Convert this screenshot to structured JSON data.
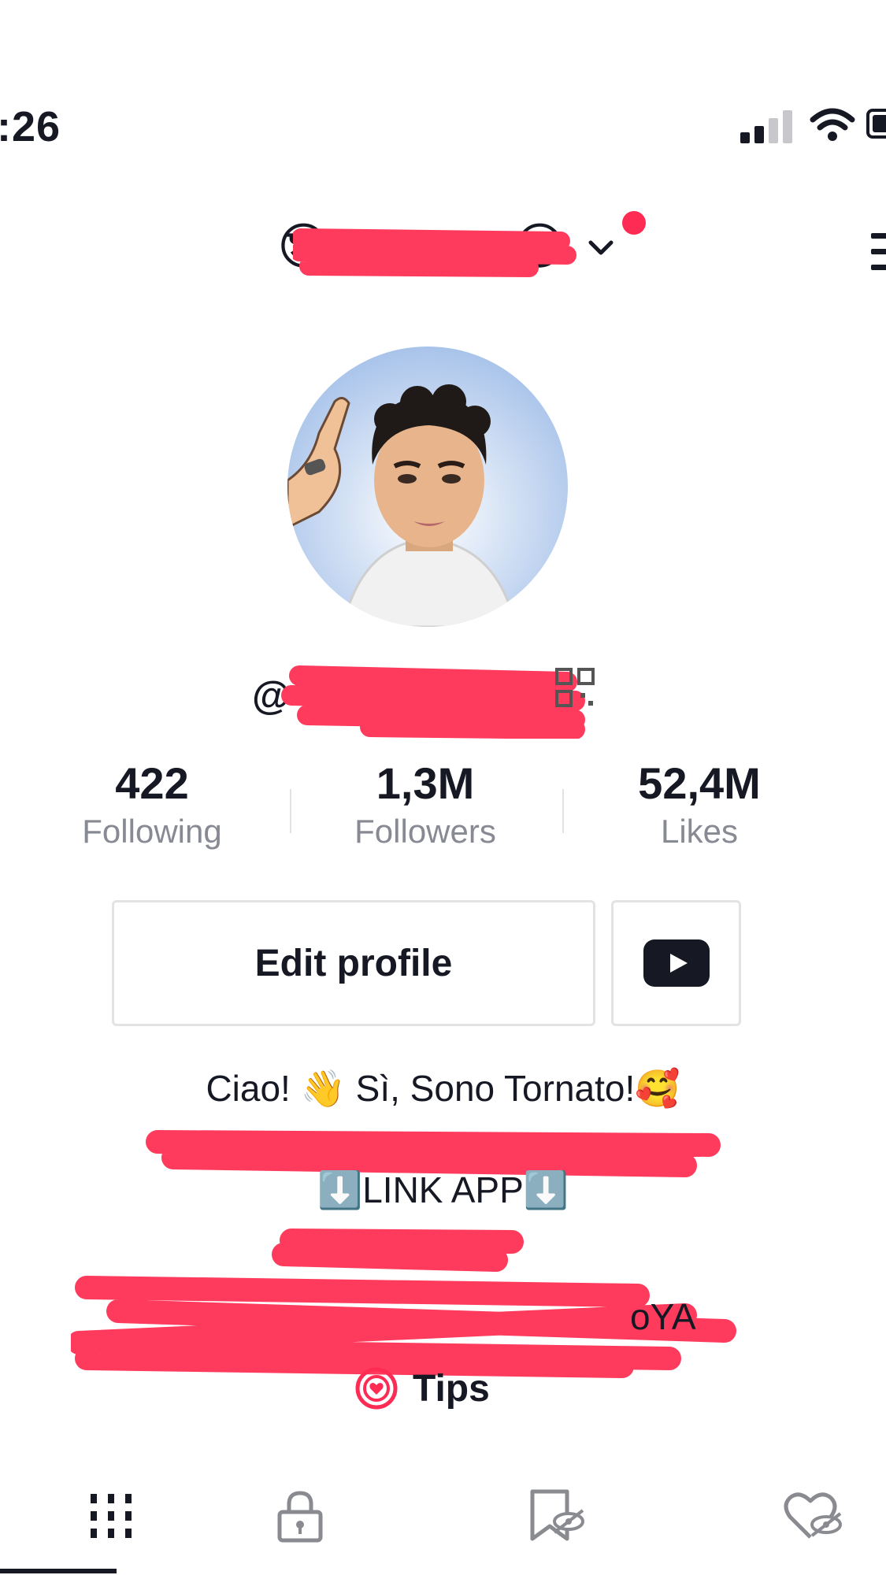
{
  "status_bar": {
    "time": ":26"
  },
  "header": {
    "emoji_left": "😎",
    "emoji_right": "😎"
  },
  "stats": [
    {
      "value": "422",
      "label": "Following"
    },
    {
      "value": "1,3M",
      "label": "Followers"
    },
    {
      "value": "52,4M",
      "label": "Likes"
    }
  ],
  "actions": {
    "edit_profile": "Edit profile"
  },
  "bio": {
    "line1": "Ciao! 👋 Sì, Sono Tornato!🥰",
    "line3": "⬇️LINK APP⬇️",
    "tail": "oYA"
  },
  "tips": {
    "label": "Tips"
  },
  "colors": {
    "accent": "#fe2c55",
    "text": "#161823",
    "muted": "#878993",
    "border": "#e3e3e4"
  },
  "icons": [
    "signal-icon",
    "wifi-icon",
    "battery-icon",
    "chevron-down-icon",
    "menu-icon",
    "qr-code-icon",
    "youtube-icon",
    "tips-heart-icon",
    "grid-icon",
    "lock-icon",
    "bookmark-hidden-icon",
    "heart-hidden-icon"
  ]
}
